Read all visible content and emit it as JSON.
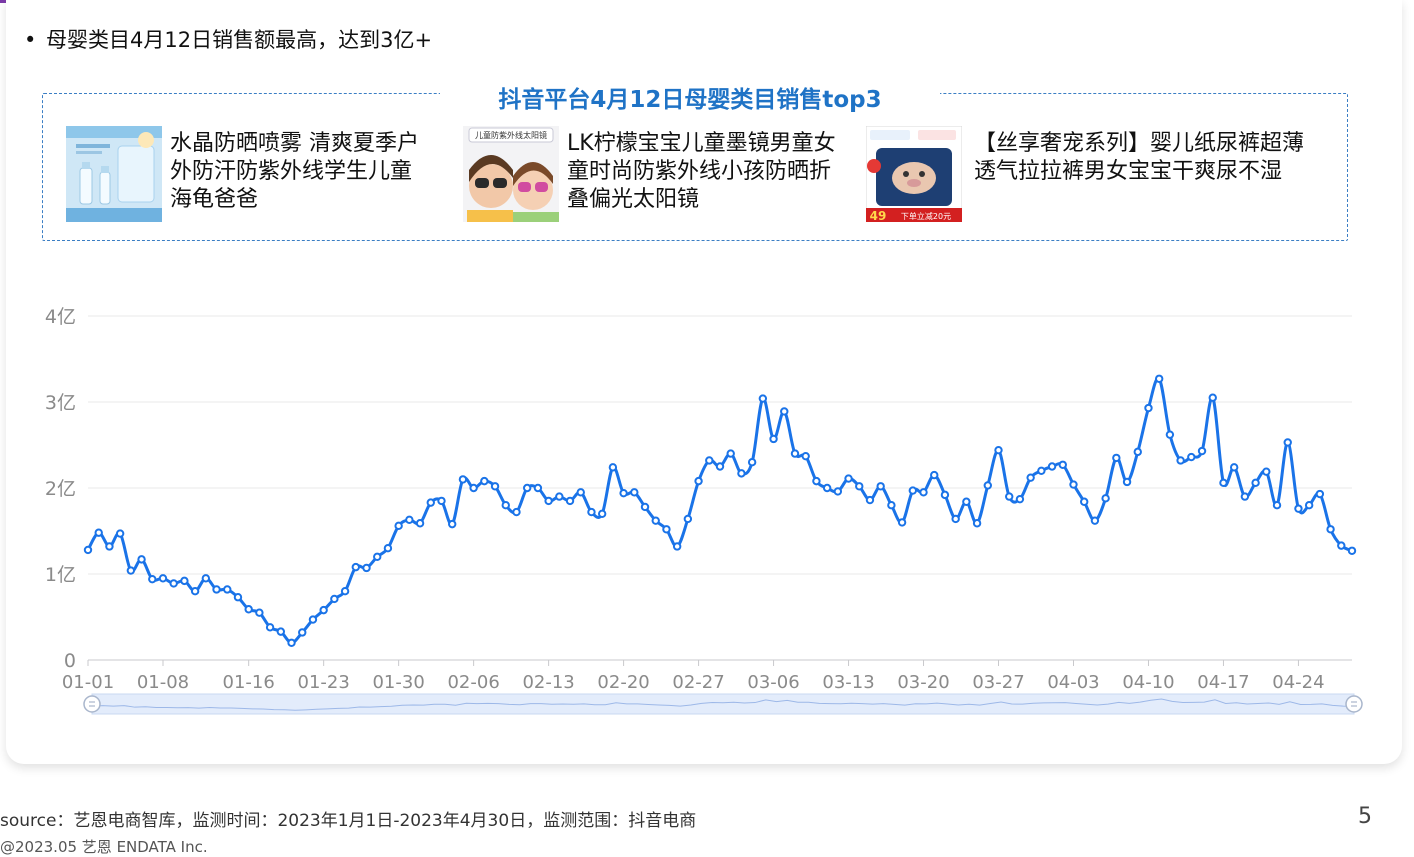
{
  "headline": "母婴类目4月12日销售额最高，达到3亿+",
  "bullet_symbol": "•",
  "box_title": "抖音平台4月12日母婴类目销售top3",
  "products": [
    {
      "name": "水晶防晒喷雾 清爽夏季户外防汗防紫外线学生儿童海龟爸爸",
      "image_icon": "sunscreen-spray-product-image"
    },
    {
      "name": "LK柠檬宝宝儿童墨镜男童女童时尚防紫外线小孩防晒折叠偏光太阳镜",
      "image_icon": "kids-sunglasses-product-image",
      "image_caption": "儿童防紫外线太阳镜"
    },
    {
      "name": "【丝享奢宠系列】婴儿纸尿裤超薄透气拉拉裤男女宝宝干爽尿不湿",
      "image_icon": "diaper-product-image",
      "image_caption": "下单立减20元",
      "image_price": "49"
    }
  ],
  "chart_data": {
    "type": "line",
    "title": "",
    "xlabel": "",
    "ylabel": "",
    "ylim": [
      0,
      4
    ],
    "y_ticks": [
      "0",
      "1亿",
      "2亿",
      "3亿",
      "4亿"
    ],
    "x_tick_labels": [
      "01-01",
      "01-08",
      "01-16",
      "01-23",
      "01-30",
      "02-06",
      "02-13",
      "02-20",
      "02-27",
      "03-06",
      "03-13",
      "03-20",
      "03-27",
      "04-03",
      "04-10",
      "04-17",
      "04-24"
    ],
    "x_tick_day_index": [
      0,
      7,
      15,
      22,
      29,
      36,
      43,
      50,
      57,
      64,
      71,
      78,
      85,
      92,
      99,
      106,
      113
    ],
    "grid": true,
    "color": "#1a73e8",
    "series": [
      {
        "unit": "亿",
        "start": "2023-01-01",
        "end": "2023-04-30",
        "values": [
          1.28,
          1.48,
          1.32,
          1.47,
          1.04,
          1.17,
          0.94,
          0.95,
          0.89,
          0.92,
          0.8,
          0.95,
          0.82,
          0.82,
          0.73,
          0.59,
          0.55,
          0.38,
          0.33,
          0.2,
          0.32,
          0.47,
          0.58,
          0.71,
          0.8,
          1.08,
          1.07,
          1.2,
          1.3,
          1.56,
          1.63,
          1.59,
          1.83,
          1.85,
          1.58,
          2.1,
          2.0,
          2.08,
          2.02,
          1.8,
          1.72,
          2.0,
          2.0,
          1.85,
          1.9,
          1.85,
          1.95,
          1.72,
          1.7,
          2.24,
          1.94,
          1.95,
          1.78,
          1.62,
          1.52,
          1.32,
          1.64,
          2.08,
          2.32,
          2.25,
          2.4,
          2.17,
          2.3,
          3.04,
          2.57,
          2.89,
          2.4,
          2.37,
          2.08,
          2.0,
          1.96,
          2.11,
          2.02,
          1.86,
          2.02,
          1.8,
          1.6,
          1.97,
          1.95,
          2.15,
          1.92,
          1.64,
          1.84,
          1.59,
          2.03,
          2.44,
          1.9,
          1.87,
          2.12,
          2.2,
          2.25,
          2.27,
          2.04,
          1.84,
          1.62,
          1.88,
          2.35,
          2.07,
          2.42,
          2.93,
          3.27,
          2.62,
          2.32,
          2.36,
          2.43,
          3.05,
          2.06,
          2.24,
          1.9,
          2.06,
          2.19,
          1.8,
          2.53,
          1.76,
          1.8,
          1.93,
          1.52,
          1.33,
          1.27
        ]
      }
    ],
    "datazoom_slider": true
  },
  "footer": {
    "source": "source：艺恩电商智库，监测时间：2023年1月1日-2023年4月30日，监测范围：抖音电商",
    "page_number": "5",
    "copyright": "@2023.05 艺恩 ENDATA Inc."
  }
}
